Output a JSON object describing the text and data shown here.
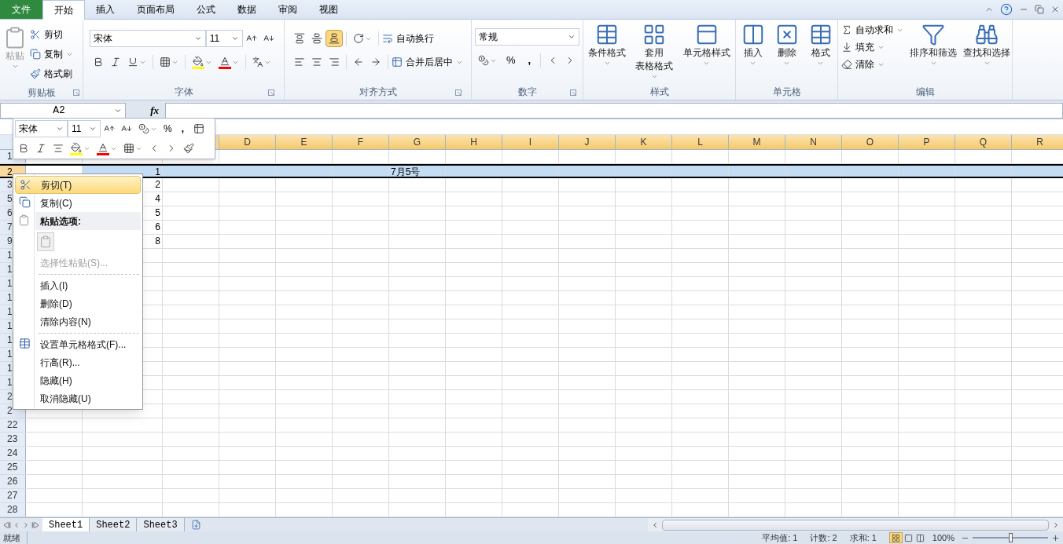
{
  "tabs": [
    {
      "label": "文件",
      "kind": "file",
      "selected": false
    },
    {
      "label": "开始",
      "kind": "tab",
      "selected": true
    },
    {
      "label": "插入",
      "kind": "tab",
      "selected": false
    },
    {
      "label": "页面布局",
      "kind": "tab",
      "selected": false
    },
    {
      "label": "公式",
      "kind": "tab",
      "selected": false
    },
    {
      "label": "数据",
      "kind": "tab",
      "selected": false
    },
    {
      "label": "审阅",
      "kind": "tab",
      "selected": false
    },
    {
      "label": "视图",
      "kind": "tab",
      "selected": false
    }
  ],
  "ribbon": {
    "clipboard": {
      "label": "剪贴板",
      "paste": {
        "label": "粘贴",
        "disabled": true
      },
      "actions": [
        "剪切",
        "复制",
        "格式刷"
      ]
    },
    "font": {
      "label": "字体",
      "font_name": "宋体",
      "font_size": "11"
    },
    "alignment": {
      "label": "对齐方式",
      "vertical": [
        {
          "kind": "top",
          "selected": false
        },
        {
          "kind": "middle",
          "selected": false
        },
        {
          "kind": "bottom",
          "selected": true
        }
      ],
      "wrap": "自动换行",
      "merge": "合并后居中"
    },
    "number": {
      "label": "数字",
      "format": "常规",
      "percent": "%",
      "comma": ","
    },
    "styles": {
      "label": "样式",
      "buttons": [
        {
          "lines": [
            "条件格式"
          ]
        },
        {
          "lines": [
            "套用",
            "表格格式"
          ]
        },
        {
          "lines": [
            "单元格样式"
          ]
        }
      ]
    },
    "cells": {
      "label": "单元格",
      "buttons": [
        "插入",
        "删除",
        "格式"
      ]
    },
    "editing": {
      "label": "编辑",
      "small": [
        "自动求和",
        "填充",
        "清除"
      ],
      "large": [
        "排序和筛选",
        "查找和选择"
      ]
    }
  },
  "formula_bar": {
    "name_box": "A2",
    "fx": "fx"
  },
  "mini_toolbar": {
    "font_name": "宋体",
    "font_size": "11",
    "percent": "%",
    "comma": ","
  },
  "sheet": {
    "columns": [
      {
        "label": "D",
        "highlighted": true
      },
      {
        "label": "E",
        "highlighted": true
      },
      {
        "label": "F",
        "highlighted": true
      },
      {
        "label": "G",
        "highlighted": true
      },
      {
        "label": "H",
        "highlighted": true
      },
      {
        "label": "I",
        "highlighted": true
      },
      {
        "label": "J",
        "highlighted": true
      },
      {
        "label": "K",
        "highlighted": true
      },
      {
        "label": "L",
        "highlighted": true
      },
      {
        "label": "M",
        "highlighted": true
      },
      {
        "label": "N",
        "highlighted": true
      },
      {
        "label": "O",
        "highlighted": true
      },
      {
        "label": "P",
        "highlighted": true
      },
      {
        "label": "Q",
        "highlighted": true
      },
      {
        "label": "R",
        "highlighted": true
      }
    ],
    "rows": [
      {
        "label": "1",
        "selected": false
      },
      {
        "label": "2",
        "selected": true,
        "column_b": "1",
        "column_g": "7月5号"
      },
      {
        "label": "3",
        "selected": false,
        "column_b": "2"
      },
      {
        "label": "5",
        "selected": false,
        "column_b": "4"
      },
      {
        "label": "6",
        "selected": false,
        "column_b": "5"
      },
      {
        "label": "7",
        "selected": false,
        "column_b": "6"
      },
      {
        "label": "9",
        "selected": false,
        "column_b": "8"
      },
      {
        "label": "1",
        "selected": false
      },
      {
        "label": "1",
        "selected": false
      },
      {
        "label": "1",
        "selected": false
      },
      {
        "label": "1",
        "selected": false
      },
      {
        "label": "1",
        "selected": false
      },
      {
        "label": "1",
        "selected": false
      },
      {
        "label": "1",
        "selected": false
      },
      {
        "label": "1",
        "selected": false
      },
      {
        "label": "1",
        "selected": false
      },
      {
        "label": "1",
        "selected": false
      },
      {
        "label": "2",
        "selected": false
      },
      {
        "label": "2",
        "selected": false
      },
      {
        "label": "22",
        "selected": false
      },
      {
        "label": "23",
        "selected": false
      },
      {
        "label": "24",
        "selected": false
      },
      {
        "label": "25",
        "selected": false
      },
      {
        "label": "26",
        "selected": false
      },
      {
        "label": "27",
        "selected": false
      },
      {
        "label": "28",
        "selected": false
      }
    ]
  },
  "context_menu": [
    {
      "kind": "cut",
      "label": "剪切(T)",
      "selected": true,
      "disabled": false
    },
    {
      "kind": "copy",
      "label": "复制(C)",
      "selected": false,
      "disabled": false
    },
    {
      "kind": "header",
      "label": "粘贴选项:"
    },
    {
      "kind": "paste_option"
    },
    {
      "kind": "command",
      "label": "选择性粘贴(S)...",
      "selected": false,
      "disabled": true
    },
    {
      "kind": "separator"
    },
    {
      "kind": "command",
      "label": "插入(I)",
      "selected": false,
      "disabled": false
    },
    {
      "kind": "command",
      "label": "删除(D)",
      "selected": false,
      "disabled": false
    },
    {
      "kind": "command",
      "label": "清除内容(N)",
      "selected": false,
      "disabled": false
    },
    {
      "kind": "separator"
    },
    {
      "kind": "format",
      "label": "设置单元格格式(F)...",
      "selected": false,
      "disabled": false
    },
    {
      "kind": "command",
      "label": "行高(R)...",
      "selected": false,
      "disabled": false
    },
    {
      "kind": "command",
      "label": "隐藏(H)",
      "selected": false,
      "disabled": false
    },
    {
      "kind": "command",
      "label": "取消隐藏(U)",
      "selected": false,
      "disabled": false
    }
  ],
  "sheet_tabs": [
    {
      "label": "Sheet1",
      "selected": true
    },
    {
      "label": "Sheet2",
      "selected": false
    },
    {
      "label": "Sheet3",
      "selected": false
    }
  ],
  "status_bar": {
    "ready": "就绪",
    "stats": [
      "平均值: 1",
      "计数: 2",
      "求和: 1"
    ],
    "views": [
      {
        "kind": "normal",
        "selected": true
      },
      {
        "kind": "page_layout",
        "selected": false
      },
      {
        "kind": "page_break",
        "selected": false
      }
    ],
    "zoom": "100%",
    "zoom_slider": {
      "level": 0.5
    }
  }
}
